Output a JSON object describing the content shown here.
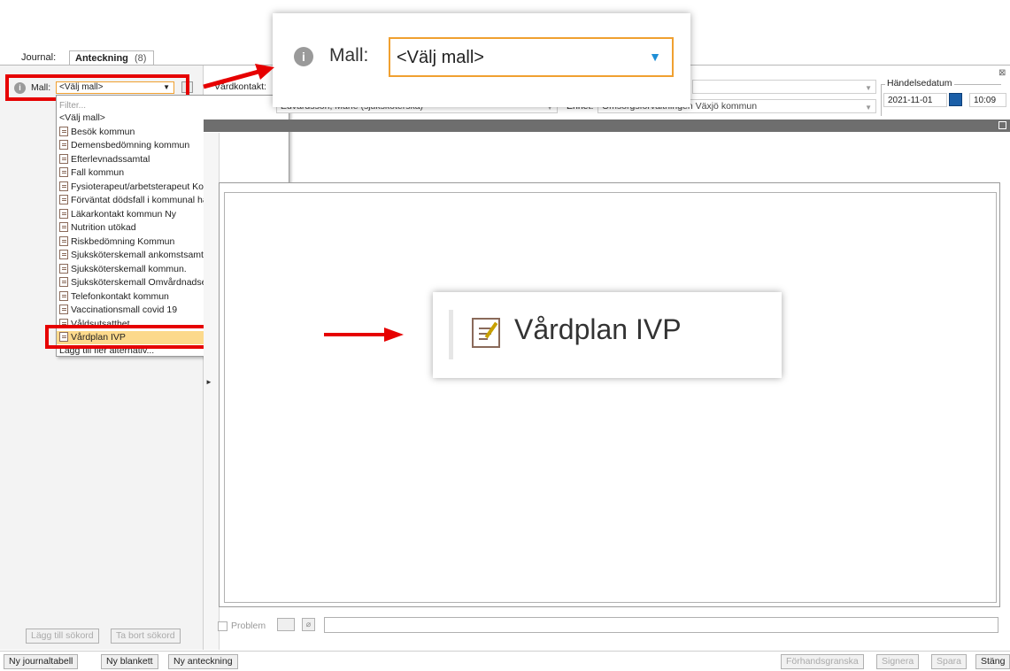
{
  "tabs": {
    "journal": "Journal:",
    "anteckning": "Anteckning",
    "anteckning_badge": "(8)"
  },
  "mall": {
    "label": "Mall:",
    "value": "<Välj mall>",
    "filter_placeholder": "Filter...",
    "items": [
      "<Välj mall>",
      "Besök kommun",
      "Demensbedömning kommun",
      "Efterlevnadssamtal",
      "Fall kommun",
      "Fysioterapeut/arbetsterapeut Kommun",
      "Förväntat dödsfall i kommunal hälso och sjukvård",
      "Läkarkontakt kommun Ny",
      "Nutrition utökad",
      "Riskbedömning Kommun",
      "Sjuksköterskemall ankomstsamtal kommun",
      "Sjuksköterskemall kommun.",
      "Sjuksköterskemall Omvårdnadsepikris kommun",
      "Telefonkontakt kommun",
      "Vaccinationsmall covid 19",
      "Våldsutsatthet",
      "Vårdplan IVP",
      "Lägg till fler alternativ..."
    ],
    "selected_item": "Vårdplan IVP"
  },
  "header": {
    "vardkontakt_label": "Vårdkontakt:",
    "vardkontakt_value": "Edvardsson, Marie (sjuksköterska)",
    "enhet_label": "Enhet:",
    "enhet_value": "Omsorgsförvaltningen Växjö kommun",
    "handelsedatum_label": "Händelsedatum",
    "date_value": "2021-11-01",
    "time_value": "10:09"
  },
  "bottom_bar": {
    "problem_label": "Problem",
    "lagg_till_sokord": "Lägg till sökord",
    "ta_bort_sokord": "Ta bort sökord",
    "ny_journaltabell": "Ny journaltabell",
    "ny_blankett": "Ny blankett",
    "ny_anteckning": "Ny anteckning",
    "forhandsgranska": "Förhandsgranska",
    "signera": "Signera",
    "spara": "Spara",
    "stang": "Stäng"
  },
  "callouts": {
    "top_label": "Mall:",
    "top_value": "<Välj mall>",
    "mid_label": "Vårdplan IVP"
  },
  "colors": {
    "highlight": "#e60000",
    "selection": "#fcd98b",
    "accent_arrow": "#1f8fd6"
  }
}
